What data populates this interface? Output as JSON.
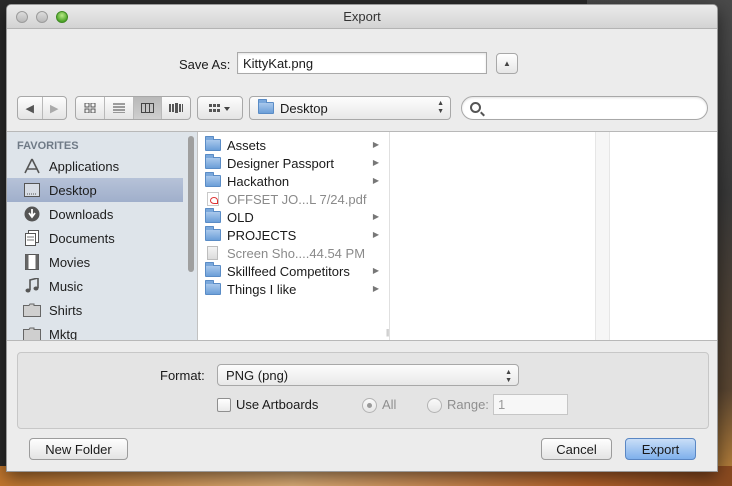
{
  "window": {
    "title": "Export"
  },
  "save_as": {
    "label": "Save As:",
    "value": "KittyKat.png"
  },
  "toolbar": {
    "location": "Desktop",
    "search_placeholder": ""
  },
  "sidebar": {
    "header": "FAVORITES",
    "items": [
      {
        "label": "Applications",
        "icon": "applications-icon"
      },
      {
        "label": "Desktop",
        "icon": "desktop-icon",
        "selected": true
      },
      {
        "label": "Downloads",
        "icon": "downloads-icon"
      },
      {
        "label": "Documents",
        "icon": "documents-icon"
      },
      {
        "label": "Movies",
        "icon": "movies-icon"
      },
      {
        "label": "Music",
        "icon": "music-icon"
      },
      {
        "label": "Shirts",
        "icon": "folder-icon"
      },
      {
        "label": "Mktg",
        "icon": "folder-icon"
      }
    ]
  },
  "files": [
    {
      "name": "Assets",
      "kind": "folder"
    },
    {
      "name": "Designer Passport",
      "kind": "folder"
    },
    {
      "name": "Hackathon",
      "kind": "folder"
    },
    {
      "name": "OFFSET JO...L 7/24.pdf",
      "kind": "pdf"
    },
    {
      "name": "OLD",
      "kind": "folder"
    },
    {
      "name": "PROJECTS",
      "kind": "folder"
    },
    {
      "name": "Screen Sho....44.54 PM",
      "kind": "image"
    },
    {
      "name": "Skillfeed Competitors",
      "kind": "folder"
    },
    {
      "name": "Things I like",
      "kind": "folder"
    }
  ],
  "options": {
    "format_label": "Format:",
    "format_value": "PNG (png)",
    "use_artboards_label": "Use Artboards",
    "all_label": "All",
    "range_label": "Range:",
    "range_value": "1"
  },
  "buttons": {
    "new_folder": "New Folder",
    "cancel": "Cancel",
    "export": "Export"
  },
  "colors": {
    "selection": "#a9b6cf",
    "primary_button": "#7fb0ec",
    "sidebar_bg": "#dee4ea"
  }
}
